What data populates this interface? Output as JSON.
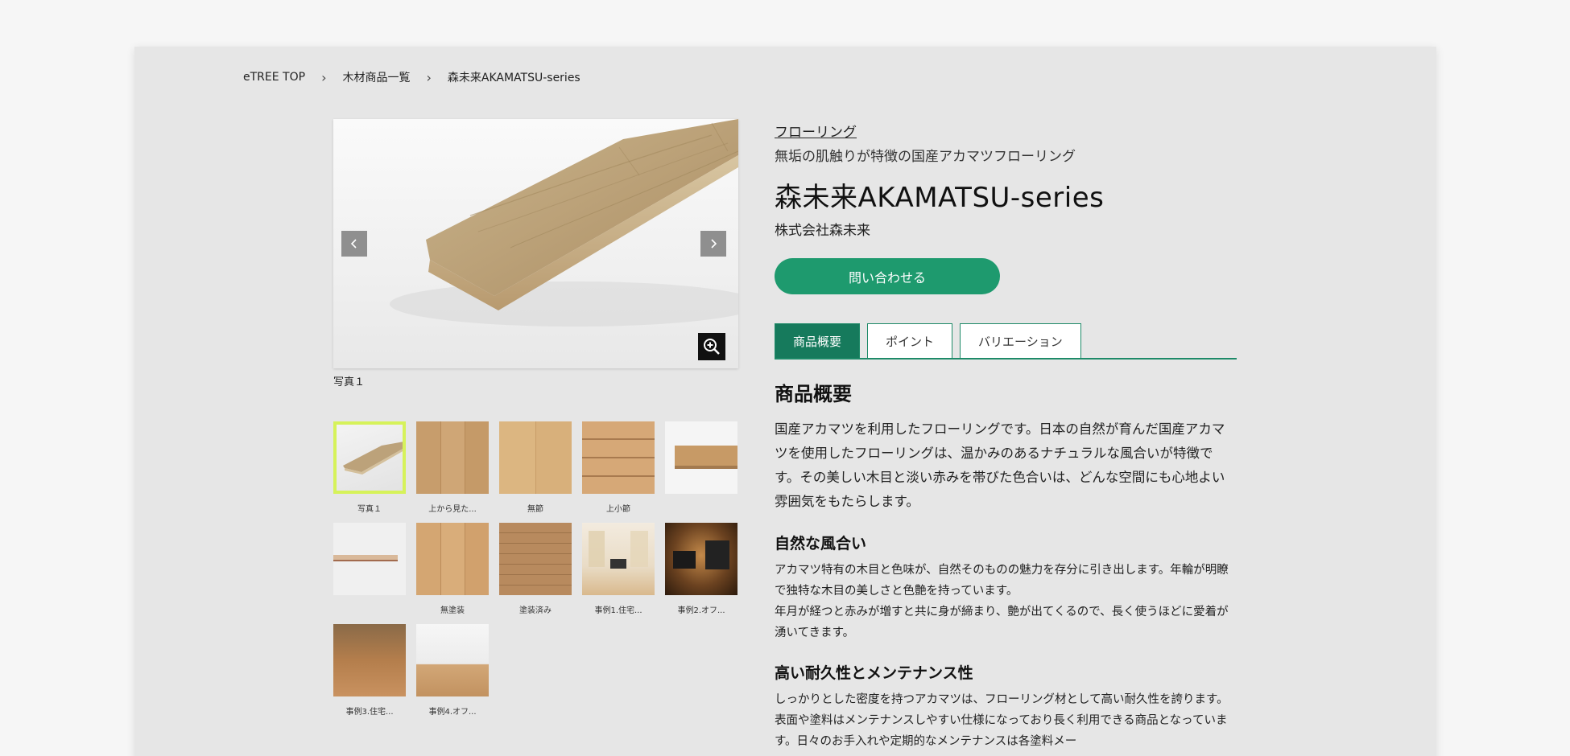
{
  "breadcrumb": [
    "eTREE TOP",
    "木材商品一覧",
    "森未来AKAMATSU-series"
  ],
  "breadcrumb_sep": "›",
  "viewer": {
    "caption": "写真１",
    "prev_icon": "chevron-left-icon",
    "next_icon": "chevron-right-icon",
    "zoom_icon": "zoom-in-icon"
  },
  "thumbnails": [
    {
      "label": "写真１",
      "active": true
    },
    {
      "label": "上から見た..."
    },
    {
      "label": "無節"
    },
    {
      "label": "上小節"
    },
    {
      "label": ""
    },
    {
      "label": ""
    },
    {
      "label": "無塗装"
    },
    {
      "label": "塗装済み"
    },
    {
      "label": "事例1.住宅..."
    },
    {
      "label": "事例2.オフ..."
    },
    {
      "label": "事例3.住宅..."
    },
    {
      "label": "事例4.オフ..."
    }
  ],
  "product": {
    "category": "フローリング",
    "subtitle": "無垢の肌触りが特徴の国産アカマツフローリング",
    "title": "森未来AKAMATSU-series",
    "maker": "株式会社森未来",
    "contact_label": "問い合わせる"
  },
  "tabs": [
    "商品概要",
    "ポイント",
    "バリエーション"
  ],
  "overview": {
    "heading": "商品概要",
    "lead": "国産アカマツを利用したフローリングです。日本の自然が育んだ国産アカマツを使用したフローリングは、温かみのあるナチュラルな風合いが特徴です。その美しい木目と淡い赤みを帯びた色合いは、どんな空間にも心地よい雰囲気をもたらします。",
    "s1_heading": "自然な風合い",
    "s1_body1": "アカマツ特有の木目と色味が、自然そのものの魅力を存分に引き出します。年輪が明瞭で独特な木目の美しさと色艶を持っています。",
    "s1_body2": "年月が経つと赤みが増すと共に身が締まり、艶が出てくるので、長く使うほどに愛着が湧いてきます。",
    "s2_heading": "高い耐久性とメンテナンス性",
    "s2_body": "しっかりとした密度を持つアカマツは、フローリング材として高い耐久性を誇ります。表面や塗料はメンテナンスしやすい仕様になっており長く利用できる商品となっています。日々のお手入れや定期的なメンテナンスは各塗料メー"
  }
}
